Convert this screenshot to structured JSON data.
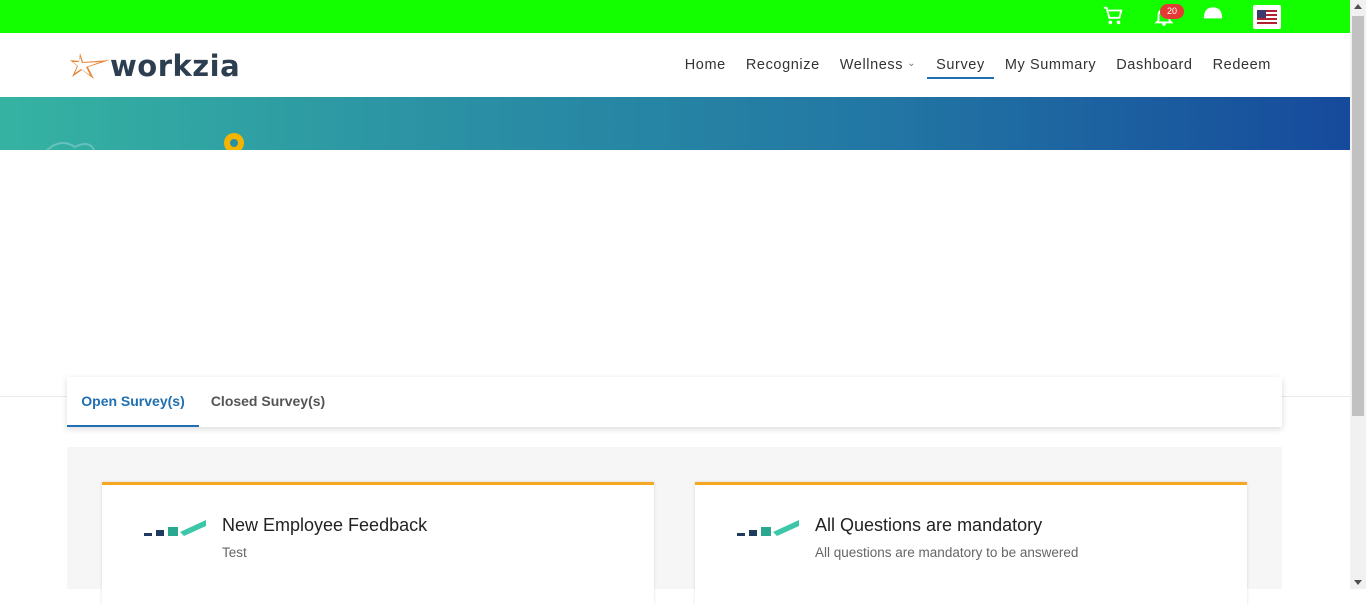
{
  "topbar": {
    "background": "#13ff00",
    "cart_icon": "cart-icon",
    "bell_icon": "bell-icon",
    "notification_count": "20",
    "avatar_icon": "user-avatar-icon",
    "flag_icon": "us-flag-icon"
  },
  "brand": {
    "name": "workzia",
    "logo_icon": "star-logo-icon",
    "accent": "#e8873a"
  },
  "nav": {
    "items": [
      {
        "label": "Home"
      },
      {
        "label": "Recognize"
      },
      {
        "label": "Wellness"
      },
      {
        "label": "Survey",
        "active": true
      },
      {
        "label": "My Summary"
      },
      {
        "label": "Dashboard"
      },
      {
        "label": "Redeem"
      }
    ]
  },
  "tabs": {
    "open": "Open Survey(s)",
    "closed": "Closed Survey(s)"
  },
  "surveys": [
    {
      "title": "New Employee Feedback",
      "description": "Test"
    },
    {
      "title": "All Questions are mandatory",
      "description": "All questions are mandatory to be answered"
    }
  ],
  "colors": {
    "active_tab": "#1f6fb2",
    "card_accent": "#f5a623",
    "hero_start": "#35b3a2",
    "hero_end": "#164a9c"
  }
}
